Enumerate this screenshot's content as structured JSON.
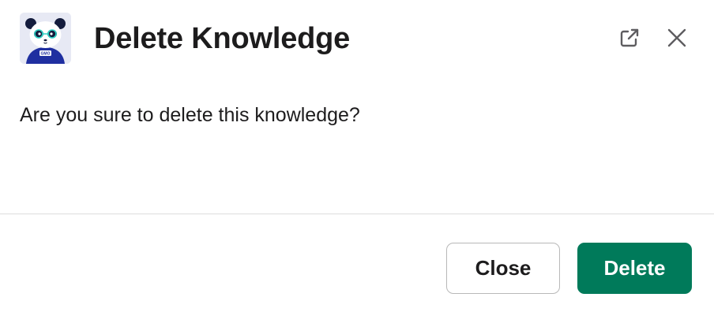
{
  "modal": {
    "title": "Delete Knowledge",
    "message": "Are you sure to delete this knowledge?",
    "app_icon": "panda-mascot-icon",
    "avatar_badge_text": "GMO",
    "header_actions": [
      {
        "icon": "external-link-icon"
      },
      {
        "icon": "close-icon"
      }
    ]
  },
  "footer": {
    "close_label": "Close",
    "delete_label": "Delete"
  },
  "colors": {
    "primary": "#007a5a",
    "text": "#1d1c1d",
    "divider": "#dddddd",
    "avatar_bg": "#e7e9f4"
  }
}
